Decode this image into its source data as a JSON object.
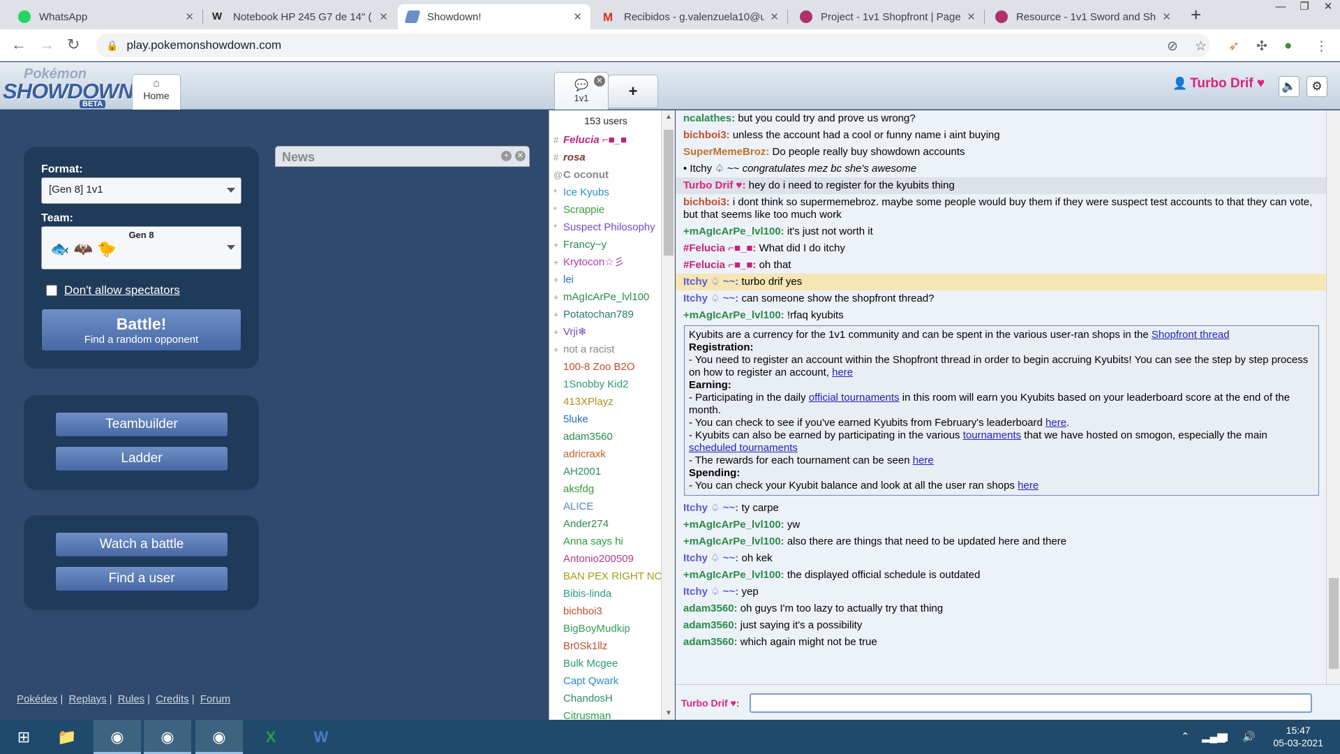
{
  "browser": {
    "tabs": [
      {
        "title": "WhatsApp",
        "icon": "whatsapp-icon"
      },
      {
        "title": "Notebook HP 245 G7 de 14\" (",
        "icon": "word-w-icon"
      },
      {
        "title": "Showdown!",
        "icon": "showdown-icon"
      },
      {
        "title": "Recibidos - g.valenzuela10@u",
        "icon": "gmail-icon"
      },
      {
        "title": "Project - 1v1 Shopfront | Page",
        "icon": "smogon-icon"
      },
      {
        "title": "Resource - 1v1 Sword and Shi",
        "icon": "smogon-icon"
      }
    ],
    "url": "play.pokemonshowdown.com"
  },
  "header": {
    "logo_top": "Pokémon",
    "logo_main": "SHOWDOWN",
    "logo_badge": "BETA",
    "home_tab": "Home",
    "room_tab": "1v1",
    "plus": "+",
    "username": "Turbo Drif ♥"
  },
  "main": {
    "format_label": "Format:",
    "format_value": "[Gen 8] 1v1",
    "team_label": "Team:",
    "team_gen": "Gen 8",
    "spectators_label": "Don't allow spectators",
    "battle_title": "Battle!",
    "battle_sub": "Find a random opponent",
    "teambuilder": "Teambuilder",
    "ladder": "Ladder",
    "watch": "Watch a battle",
    "find_user": "Find a user",
    "news_title": "News",
    "footer_links": [
      "Pokédex",
      "Replays",
      "Rules",
      "Credits",
      "Forum"
    ]
  },
  "userlist": {
    "count": "153 users",
    "users": [
      {
        "group": "#",
        "name": "Felucia ⌐■_■",
        "color": "#c0247a",
        "style": "italic"
      },
      {
        "group": "#",
        "name": "rosa",
        "color": "#7a3b2a",
        "style": "italic"
      },
      {
        "group": "@",
        "name": "C oconut",
        "color": "#888888",
        "style": "bold"
      },
      {
        "group": "*",
        "name": "Ice Kyubs",
        "color": "#2a8bc8",
        "style": ""
      },
      {
        "group": "*",
        "name": "Scrappie",
        "color": "#3a9a3a",
        "style": ""
      },
      {
        "group": "*",
        "name": "Suspect Philosophy",
        "color": "#6a4bc8",
        "style": ""
      },
      {
        "group": "+",
        "name": "Francy~y",
        "color": "#2a8a4a",
        "style": ""
      },
      {
        "group": "+",
        "name": "Krytocon☆彡",
        "color": "#b03ab0",
        "style": ""
      },
      {
        "group": "+",
        "name": "lei",
        "color": "#2a6ac8",
        "style": ""
      },
      {
        "group": "+",
        "name": "mAgIcArPe_lvl100",
        "color": "#2a8a4a",
        "style": ""
      },
      {
        "group": "+",
        "name": "Potatochan789",
        "color": "#2a7a6a",
        "style": ""
      },
      {
        "group": "+",
        "name": "Vrji❄",
        "color": "#6a4bc8",
        "style": ""
      },
      {
        "group": "+",
        "name": "not a racist",
        "color": "#888888",
        "style": ""
      },
      {
        "group": "",
        "name": "100-8 Zoo B2O",
        "color": "#c84a2a",
        "style": ""
      },
      {
        "group": "",
        "name": "1Snobby Kid2",
        "color": "#2a9a6a",
        "style": ""
      },
      {
        "group": "",
        "name": "413XPlayz",
        "color": "#b0901a",
        "style": ""
      },
      {
        "group": "",
        "name": "5luke",
        "color": "#2a6ac8",
        "style": ""
      },
      {
        "group": "",
        "name": "adam3560",
        "color": "#2a8a4a",
        "style": ""
      },
      {
        "group": "",
        "name": "adricraxk",
        "color": "#c0602a",
        "style": ""
      },
      {
        "group": "",
        "name": "AH2001",
        "color": "#2a8a6a",
        "style": ""
      },
      {
        "group": "",
        "name": "aksfdg",
        "color": "#3a9a3a",
        "style": ""
      },
      {
        "group": "",
        "name": "ALICE",
        "color": "#4a8ac8",
        "style": ""
      },
      {
        "group": "",
        "name": "Ander274",
        "color": "#2a8a4a",
        "style": ""
      },
      {
        "group": "",
        "name": "Anna says hi",
        "color": "#2a9a3a",
        "style": ""
      },
      {
        "group": "",
        "name": "Antonio200509",
        "color": "#b03a8a",
        "style": ""
      },
      {
        "group": "",
        "name": "BAN PEX RIGHT NOW",
        "color": "#9aa01a",
        "style": ""
      },
      {
        "group": "",
        "name": "Bibis-linda",
        "color": "#2a9a8a",
        "style": ""
      },
      {
        "group": "",
        "name": "bichboi3",
        "color": "#c0502a",
        "style": ""
      },
      {
        "group": "",
        "name": "BigBoyMudkip",
        "color": "#3a9a5a",
        "style": ""
      },
      {
        "group": "",
        "name": "Br0Sk1llz",
        "color": "#c0502a",
        "style": ""
      },
      {
        "group": "",
        "name": "Bulk Mcgee",
        "color": "#2a9a6a",
        "style": ""
      },
      {
        "group": "",
        "name": "Capt Qwark",
        "color": "#2a8ac8",
        "style": ""
      },
      {
        "group": "",
        "name": "ChandosH",
        "color": "#2a8a6a",
        "style": ""
      },
      {
        "group": "",
        "name": "Citrusman",
        "color": "#2a9a4a",
        "style": ""
      }
    ]
  },
  "chat": {
    "messages": [
      {
        "user": "ncalathes:",
        "color": "#2a8a4a",
        "text": "but you could try and prove us wrong?",
        "type": ""
      },
      {
        "user": "bichboi3:",
        "color": "#c0502a",
        "text": "unless the account had a cool or funny name i aint buying",
        "type": ""
      },
      {
        "user": "SuperMemeBroz:",
        "color": "#c0702a",
        "text": "Do people really buy showdown accounts",
        "type": ""
      },
      {
        "user": "• Itchy ♤ ~~",
        "color": "#000000",
        "text": "congratulates mez bc she's awesome",
        "type": "emote"
      },
      {
        "user": "Turbo Drif ♥:",
        "color": "#e01f7e",
        "text": "hey do i need to register for the kyubits thing",
        "type": "me"
      },
      {
        "user": "bichboi3:",
        "color": "#c0502a",
        "text": "i dont think so supermemebroz. maybe some people would buy them if they were suspect test accounts to that they can vote, but that seems like too much work",
        "type": ""
      },
      {
        "user": "+mAgIcArPe_lvl100:",
        "color": "#2a8a4a",
        "text": "it's just not worth it",
        "type": ""
      },
      {
        "user": "#Felucia ⌐■_■:",
        "color": "#c0247a",
        "text": "What did I do itchy",
        "type": ""
      },
      {
        "user": "#Felucia ⌐■_■:",
        "color": "#c0247a",
        "text": "oh that",
        "type": ""
      },
      {
        "user": "Itchy ♤ ~~:",
        "color": "#5a5ad0",
        "text": "turbo drif yes",
        "type": "hl"
      },
      {
        "user": "Itchy ♤ ~~:",
        "color": "#5a5ad0",
        "text": "can someone show the shopfront thread?",
        "type": ""
      },
      {
        "user": "+mAgIcArPe_lvl100:",
        "color": "#2a8a4a",
        "text": "!rfaq kyubits",
        "type": ""
      }
    ],
    "faq": {
      "intro": "Kyubits are a currency for the 1v1 community and can be spent in the various user-ran shops in the ",
      "intro_link": "Shopfront thread",
      "reg_title": "Registration:",
      "reg_text": "- You need to register an account within the Shopfront thread in order to begin accruing Kyubits! You can see the step by step process on how to register an account, ",
      "reg_link": "here",
      "earn_title": "Earning:",
      "earn1_a": "- Participating in the daily ",
      "earn1_link": "official tournaments",
      "earn1_b": " in this room will earn you Kyubits based on your leaderboard score at the end of the month.",
      "earn2_a": "- You can check to see if you've earned Kyubits from February's leaderboard ",
      "earn2_link": "here",
      "earn2_b": ".",
      "earn3_a": "- Kyubits can also be earned by participating in the various ",
      "earn3_link": "tournaments",
      "earn3_b": " that we have hosted on smogon, especially the main ",
      "earn3_link2": "scheduled tournaments",
      "earn4_a": "- The rewards for each tournament can be seen ",
      "earn4_link": "here",
      "spend_title": "Spending:",
      "spend_a": "- You can check your Kyubit balance and look at all the user ran shops ",
      "spend_link": "here"
    },
    "messages_after": [
      {
        "user": "Itchy ♤ ~~:",
        "color": "#5a5ad0",
        "text": "ty carpe"
      },
      {
        "user": "+mAgIcArPe_lvl100:",
        "color": "#2a8a4a",
        "text": "yw"
      },
      {
        "user": "+mAgIcArPe_lvl100:",
        "color": "#2a8a4a",
        "text": "also there are things that need to be updated here and there"
      },
      {
        "user": "Itchy ♤ ~~:",
        "color": "#5a5ad0",
        "text": "oh kek"
      },
      {
        "user": "+mAgIcArPe_lvl100:",
        "color": "#2a8a4a",
        "text": "the displayed official schedule is outdated"
      },
      {
        "user": "Itchy ♤ ~~:",
        "color": "#5a5ad0",
        "text": "yep"
      },
      {
        "user": "adam3560:",
        "color": "#2a8a4a",
        "text": "oh guys I'm too lazy to actually try that thing"
      },
      {
        "user": "adam3560:",
        "color": "#2a8a4a",
        "text": "just saying it's a possibility"
      },
      {
        "user": "adam3560:",
        "color": "#2a8a4a",
        "text": "which again might not be true"
      }
    ],
    "input_name": "Turbo Drif ♥:"
  },
  "taskbar": {
    "time": "15:47",
    "date": "05-03-2021"
  }
}
